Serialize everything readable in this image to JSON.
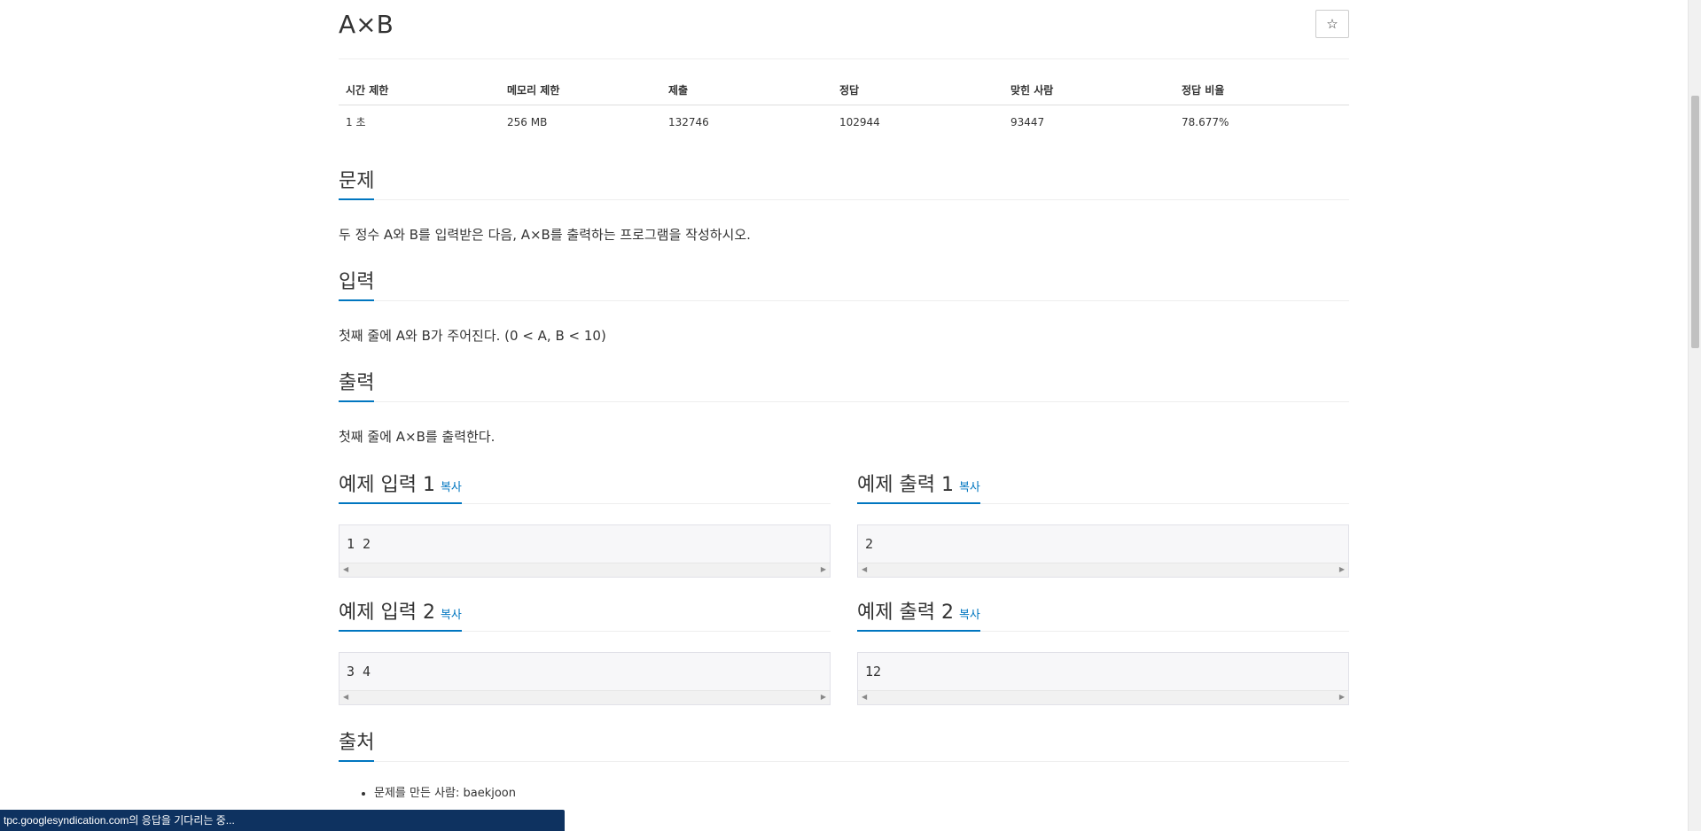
{
  "problem": {
    "title": "A×B",
    "star_icon": "☆"
  },
  "info_table": {
    "headers": [
      "시간 제한",
      "메모리 제한",
      "제출",
      "정답",
      "맞힌 사람",
      "정답 비율"
    ],
    "values": [
      "1 초",
      "256 MB",
      "132746",
      "102944",
      "93447",
      "78.677%"
    ]
  },
  "sections": {
    "problem": {
      "heading": "문제",
      "text": "두 정수 A와 B를 입력받은 다음, A×B를 출력하는 프로그램을 작성하시오."
    },
    "input": {
      "heading": "입력",
      "text": "첫째 줄에 A와 B가 주어진다. (0 < A, B < 10)"
    },
    "output": {
      "heading": "출력",
      "text": "첫째 줄에 A×B를 출력한다."
    },
    "source": {
      "heading": "출처",
      "items": [
        "문제를 만든 사람: baekjoon"
      ]
    }
  },
  "samples": {
    "copy_label": "복사",
    "input1": {
      "heading": "예제 입력 1",
      "content": "1 2"
    },
    "output1": {
      "heading": "예제 출력 1",
      "content": "2"
    },
    "input2": {
      "heading": "예제 입력 2",
      "content": "3 4"
    },
    "output2": {
      "heading": "예제 출력 2",
      "content": "12"
    }
  },
  "status_bar": {
    "text": "tpc.googlesyndication.com의 응답을 기다리는 중..."
  },
  "colors": {
    "accent": "#0076c0",
    "status_bar_bg": "#0e3260"
  }
}
